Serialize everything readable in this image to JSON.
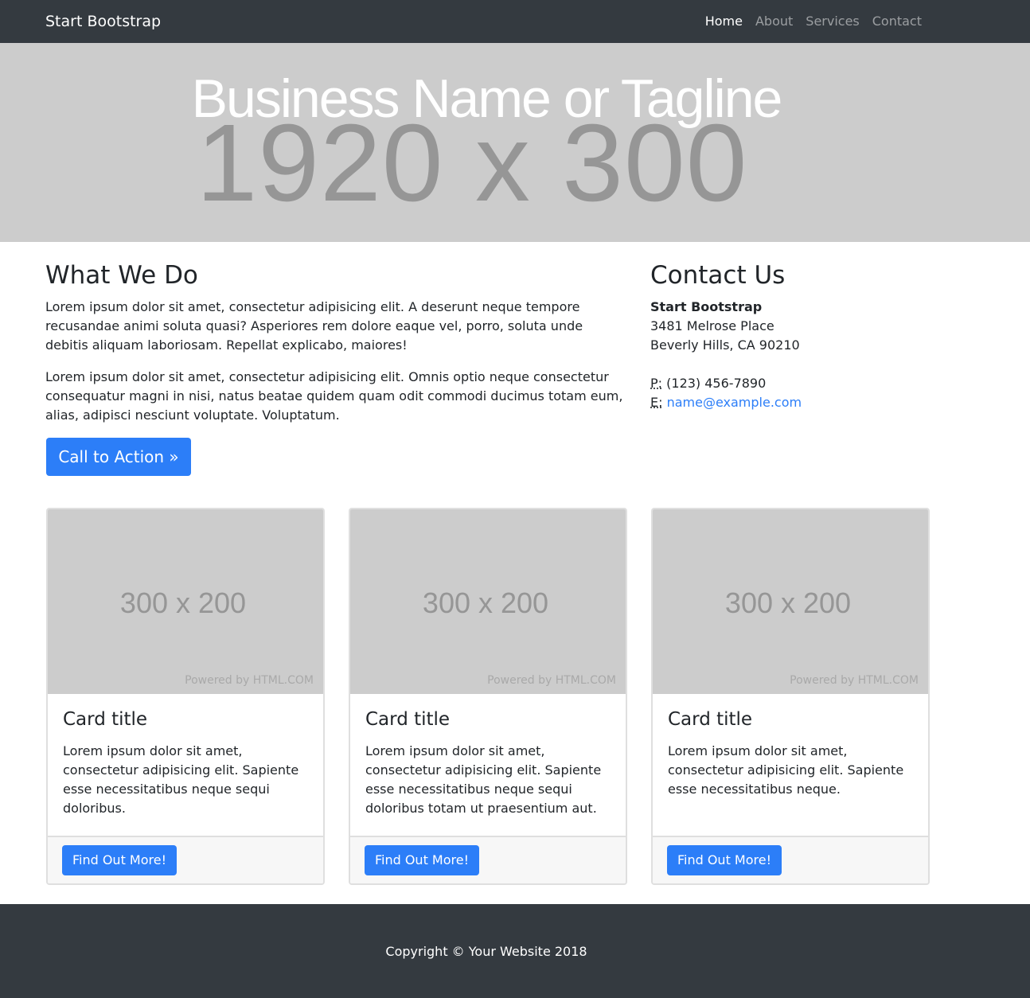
{
  "navbar": {
    "brand": "Start Bootstrap",
    "links": [
      {
        "label": "Home",
        "active": true
      },
      {
        "label": "About",
        "active": false
      },
      {
        "label": "Services",
        "active": false
      },
      {
        "label": "Contact",
        "active": false
      }
    ]
  },
  "hero": {
    "placeholder": "1920 x 300",
    "title": "Business Name or Tagline"
  },
  "what_we_do": {
    "heading": "What We Do",
    "paragraphs": [
      "Lorem ipsum dolor sit amet, consectetur adipisicing elit. A deserunt neque tempore recusandae animi soluta quasi? Asperiores rem dolore eaque vel, porro, soluta unde debitis aliquam laboriosam. Repellat explicabo, maiores!",
      "Lorem ipsum dolor sit amet, consectetur adipisicing elit. Omnis optio neque consectetur consequatur magni in nisi, natus beatae quidem quam odit commodi ducimus totam eum, alias, adipisci nesciunt voluptate. Voluptatum."
    ],
    "cta_label": "Call to Action »"
  },
  "contact": {
    "heading": "Contact Us",
    "company": "Start Bootstrap",
    "street": "3481 Melrose Place",
    "city": "Beverly Hills, CA 90210",
    "phone_abbr": "P:",
    "phone": "(123) 456-7890",
    "email_abbr": "E:",
    "email": "name@example.com"
  },
  "cards": [
    {
      "image_placeholder": "300 x 200",
      "powered_by": "Powered by HTML.COM",
      "title": "Card title",
      "text": "Lorem ipsum dolor sit amet, consectetur adipisicing elit. Sapiente esse necessitatibus neque sequi doloribus.",
      "button": "Find Out More!"
    },
    {
      "image_placeholder": "300 x 200",
      "powered_by": "Powered by HTML.COM",
      "title": "Card title",
      "text": "Lorem ipsum dolor sit amet, consectetur adipisicing elit. Sapiente esse necessitatibus neque sequi doloribus totam ut praesentium aut.",
      "button": "Find Out More!"
    },
    {
      "image_placeholder": "300 x 200",
      "powered_by": "Powered by HTML.COM",
      "title": "Card title",
      "text": "Lorem ipsum dolor sit amet, consectetur adipisicing elit. Sapiente esse necessitatibus neque.",
      "button": "Find Out More!"
    }
  ],
  "footer": {
    "copyright": "Copyright © Your Website 2018"
  },
  "colors": {
    "navbar_bg": "#343a40",
    "primary": "#2c7ef8",
    "placeholder_bg": "#cccccc"
  }
}
